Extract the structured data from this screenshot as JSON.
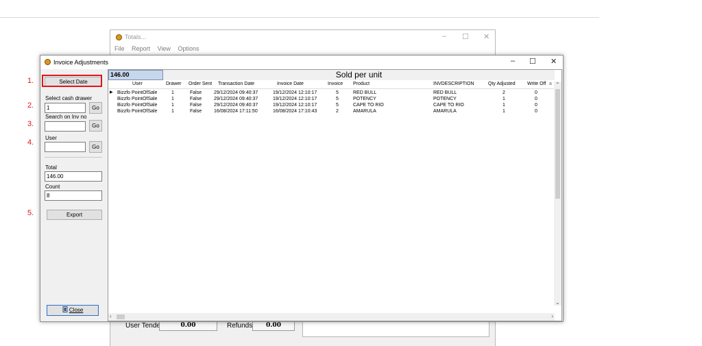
{
  "background_window": {
    "title": "Totals...",
    "menu": [
      "File",
      "Report",
      "View",
      "Options"
    ],
    "tenders_label": "User Tenders",
    "tenders_value": "0.00",
    "refunds_label": "Refunds",
    "refunds_value": "0.00"
  },
  "window": {
    "title": "Invoice Adjustments",
    "controls": {
      "minimize": "–",
      "maximize": "☐",
      "close": "✕"
    }
  },
  "sidebar": {
    "select_date": "Select Date",
    "cash_drawer_label": "Select cash drawer",
    "cash_drawer_value": "1",
    "inv_no_label": "Search on Inv no",
    "inv_no_value": "",
    "user_label": "User",
    "user_value": "",
    "go_label": "Go",
    "total_label": "Total",
    "total_value": "146.00",
    "count_label": "Count",
    "count_value": "8",
    "export_label": "Export",
    "close_label": "Close"
  },
  "grid": {
    "amount": "146.00",
    "title": "Sold per unit",
    "columns": [
      "User",
      "Drawer",
      "Order Sent",
      "Transaction Date",
      "Invoice Date",
      "Invoice",
      "Product",
      "INVDESCRIPTION",
      "Qty Adjusted",
      "Write Off",
      "a"
    ],
    "rows": [
      [
        "Bizzfo PointOfSale",
        "1",
        "False",
        "29/12/2024 09:40:37",
        "19/12/2024 12:10:17",
        "5",
        "RED BULL",
        "RED BULL",
        "2",
        "0"
      ],
      [
        "Bizzfo PointOfSale",
        "1",
        "False",
        "29/12/2024 09:40:37",
        "19/12/2024 12:10:17",
        "5",
        "POTENCY",
        "POTENCY",
        "1",
        "0"
      ],
      [
        "Bizzfo PointOfSale",
        "1",
        "False",
        "29/12/2024 09:40:37",
        "19/12/2024 12:10:17",
        "5",
        "CAPE TO RIO",
        "CAPE TO RIO",
        "1",
        "0"
      ],
      [
        "Bizzfo PointOfSale",
        "1",
        "False",
        "16/08/2024 17:11:50",
        "16/08/2024 17:10:43",
        "2",
        "AMARULA",
        "AMARULA",
        "1",
        "0"
      ]
    ]
  },
  "steps": [
    "1.",
    "2.",
    "3.",
    "4.",
    "5."
  ],
  "colors": {
    "annotation": "#e0141b",
    "amount_bg": "#c7d7ec"
  },
  "icons": {
    "app": "gold-coin-icon",
    "row_pointer": "triangle-right-icon",
    "close_button": "door-icon"
  }
}
